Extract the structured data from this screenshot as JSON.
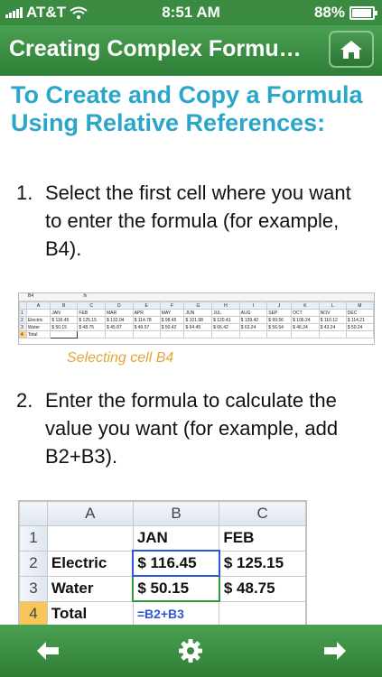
{
  "status": {
    "carrier": "AT&T",
    "time": "8:51 AM",
    "battery": "88%",
    "battery_level": 0.88
  },
  "nav": {
    "title": "Creating Complex Formu…"
  },
  "heading": "To Create and Copy a Formula Using Relative References:",
  "steps": [
    {
      "num": "1.",
      "text": "Select the first cell where you want to enter the formula (for example, B4)."
    },
    {
      "num": "2.",
      "text": "Enter the formula to calculate the value you want (for example, add B2+B3)."
    }
  ],
  "caption": "Selecting cell B4",
  "small_sheet": {
    "namebox": "B4",
    "fx": "fx",
    "columns": [
      "",
      "A",
      "B",
      "C",
      "D",
      "E",
      "F",
      "G",
      "H",
      "I",
      "J",
      "K",
      "L",
      "M"
    ],
    "rows": [
      [
        "1",
        "",
        "JAN",
        "FEB",
        "MAR",
        "APR",
        "MAY",
        "JUN",
        "JUL",
        "AUG",
        "SEP",
        "OCT",
        "NOV",
        "DEC"
      ],
      [
        "2",
        "Electric",
        "$ 116.45",
        "$ 125.15",
        "$ 132.04",
        "$ 114.78",
        "$ 98.45",
        "$ 101.98",
        "$ 120.41",
        "$ 139.42",
        "$ 99.56",
        "$ 106.24",
        "$ 110.12",
        "$ 114.21"
      ],
      [
        "3",
        "Water",
        "$ 50.15",
        "$ 48.75",
        "$ 45.87",
        "$ 49.57",
        "$ 50.42",
        "$ 64.45",
        "$ 66.42",
        "$ 63.24",
        "$ 56.54",
        "$ 46.24",
        "$ 43.24",
        "$ 50.24"
      ],
      [
        "4",
        "Total",
        "",
        "",
        "",
        "",
        "",
        "",
        "",
        "",
        "",
        "",
        "",
        ""
      ]
    ]
  },
  "big_sheet": {
    "columns": [
      "",
      "A",
      "B",
      "C"
    ],
    "rows": [
      [
        "1",
        "",
        "JAN",
        "FEB"
      ],
      [
        "2",
        "Electric",
        "$ 116.45",
        "$ 125.15"
      ],
      [
        "3",
        "Water",
        "$  50.15",
        "$   48.75"
      ],
      [
        "4",
        "Total",
        "=B2+B3",
        ""
      ]
    ]
  },
  "toolbar": {
    "back": "back-arrow-icon",
    "settings": "gear-icon",
    "forward": "forward-arrow-icon"
  },
  "colors": {
    "bar_green": "#3a8a42",
    "heading_blue": "#2aa6c8",
    "caption_orange": "#e5a43a"
  }
}
